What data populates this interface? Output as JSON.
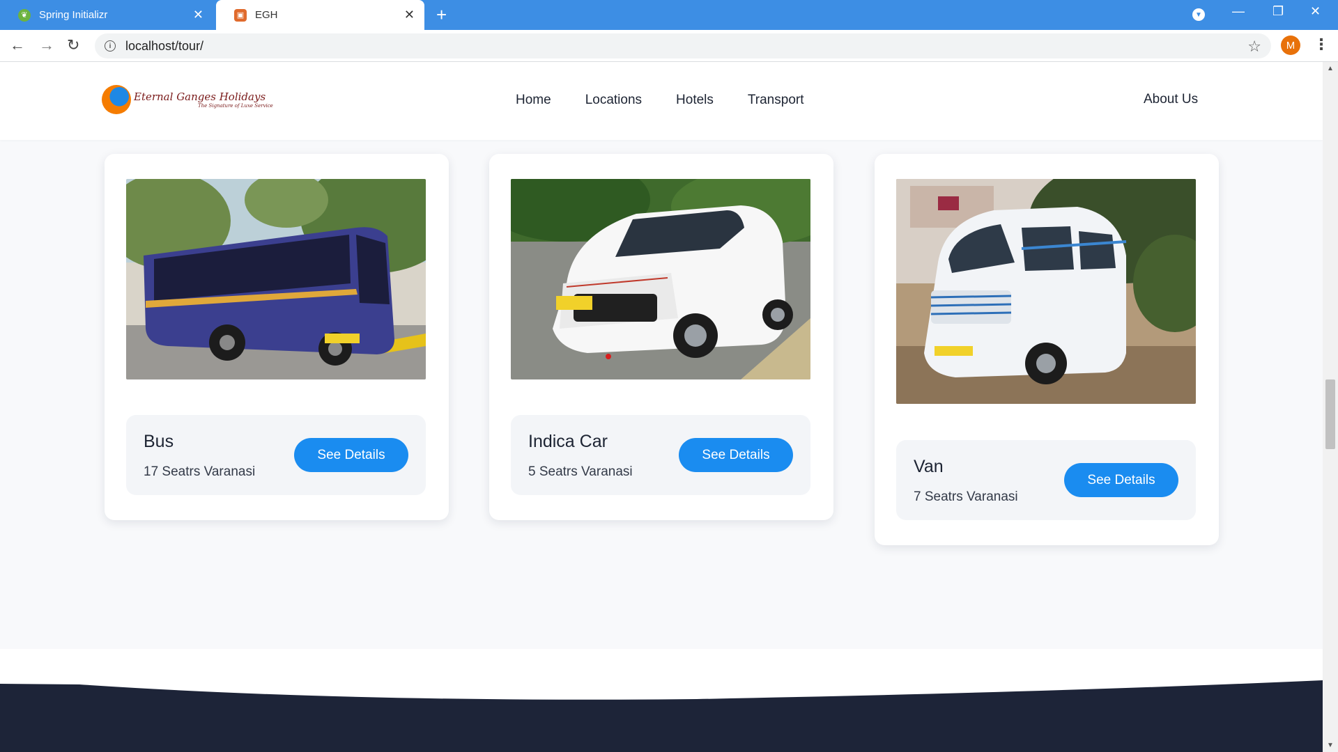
{
  "browser": {
    "tabs": [
      {
        "title": "Spring Initializr",
        "active": false
      },
      {
        "title": "EGH",
        "active": true
      }
    ],
    "url": "localhost/tour/",
    "profile_initial": "M"
  },
  "site": {
    "logo": {
      "title": "Eternal Ganges Holidays",
      "tagline": "The Signature of Luxe Service"
    },
    "nav": [
      "Home",
      "Locations",
      "Hotels",
      "Transport"
    ],
    "about": "About Us"
  },
  "vehicles": [
    {
      "name": "Bus",
      "detail": "17 Seatrs Varanasi",
      "button": "See Details",
      "body_color": "#3b3f8f"
    },
    {
      "name": "Indica Car",
      "detail": "5 Seatrs Varanasi",
      "button": "See Details",
      "body_color": "#ffffff"
    },
    {
      "name": "Van",
      "detail": "7 Seatrs Varanasi",
      "button": "See Details",
      "body_color": "#f2f4f7"
    }
  ],
  "colors": {
    "accent": "#1a8cf0",
    "footer": "#1d2438",
    "chrome": "#3d8ee4"
  }
}
